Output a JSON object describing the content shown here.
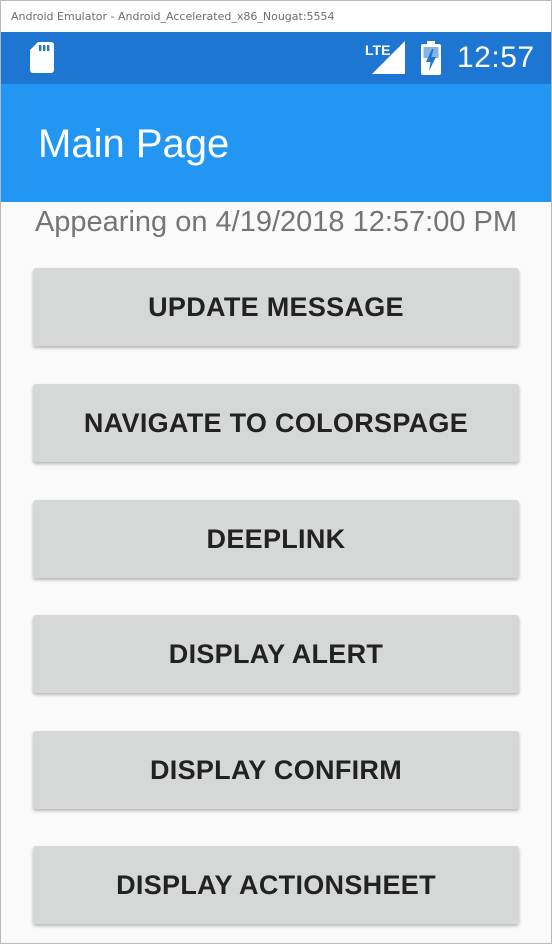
{
  "window": {
    "title": "Android Emulator - Android_Accelerated_x86_Nougat:5554"
  },
  "status_bar": {
    "left_icon": "sd-card-icon",
    "network_label": "LTE",
    "network_icon": "signal-icon",
    "battery_icon": "battery-charging-icon",
    "time": "12:57",
    "background_color": "#1c76d2"
  },
  "app_bar": {
    "title": "Main Page",
    "background_color": "#2396f3"
  },
  "main": {
    "appearing_text": "Appearing on 4/19/2018 12:57:00 PM",
    "buttons": [
      {
        "label": "UPDATE MESSAGE"
      },
      {
        "label": "NAVIGATE TO COLORSPAGE"
      },
      {
        "label": "DEEPLINK"
      },
      {
        "label": "DISPLAY ALERT"
      },
      {
        "label": "DISPLAY CONFIRM"
      },
      {
        "label": "DISPLAY ACTIONSHEET"
      }
    ]
  }
}
